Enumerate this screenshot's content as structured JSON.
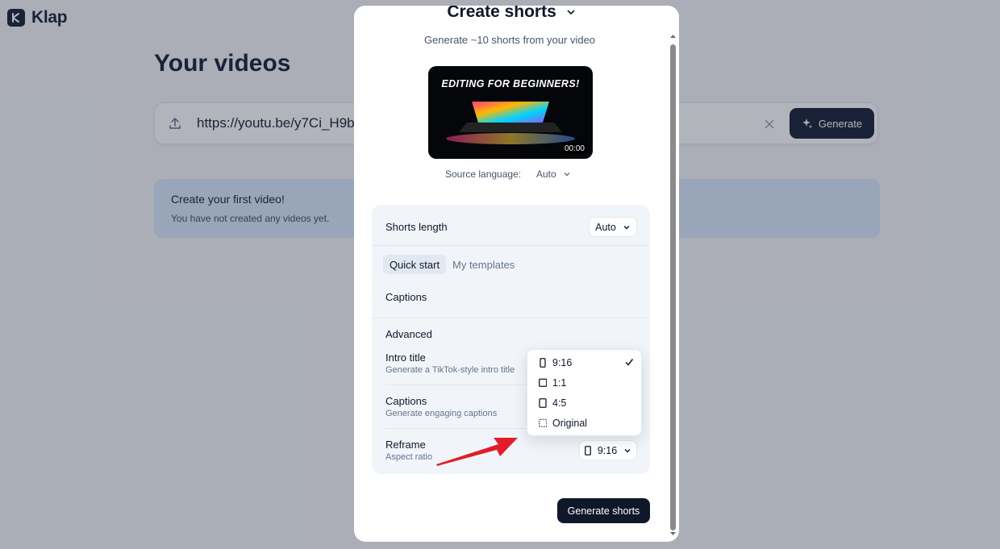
{
  "app": {
    "name": "Klap"
  },
  "page": {
    "title": "Your videos",
    "url_value": "https://youtu.be/y7Ci_H9b",
    "generate_label": "Generate",
    "empty_title": "Create your first video!",
    "empty_subtitle": "You have not created any videos yet."
  },
  "modal": {
    "title": "Create shorts",
    "subtitle": "Generate ~10 shorts from your video",
    "thumbnail": {
      "caption": "EDITING FOR BEGINNERS!",
      "duration": "00:00"
    },
    "source_language": {
      "label": "Source language:",
      "value": "Auto"
    },
    "shorts_length": {
      "label": "Shorts length",
      "value": "Auto"
    },
    "tabs": [
      {
        "label": "Quick start",
        "active": true
      },
      {
        "label": "My templates",
        "active": false
      }
    ],
    "captions_section": "Captions",
    "advanced": {
      "heading": "Advanced",
      "intro_title": {
        "label": "Intro title",
        "sub": "Generate a TikTok-style intro title"
      },
      "captions": {
        "label": "Captions",
        "sub": "Generate engaging captions"
      },
      "reframe": {
        "label": "Reframe",
        "sub": "Aspect ratio",
        "value": "9:16"
      }
    },
    "generate_button": "Generate shorts"
  },
  "reframe_dropdown": {
    "options": [
      {
        "label": "9:16",
        "selected": true
      },
      {
        "label": "1:1",
        "selected": false
      },
      {
        "label": "4:5",
        "selected": false
      },
      {
        "label": "Original",
        "selected": false
      }
    ]
  },
  "colors": {
    "primary_dark": "#0f172a",
    "slate": "#1e293b",
    "panel": "#f1f5f9",
    "annotation_arrow": "#e11d2a"
  }
}
